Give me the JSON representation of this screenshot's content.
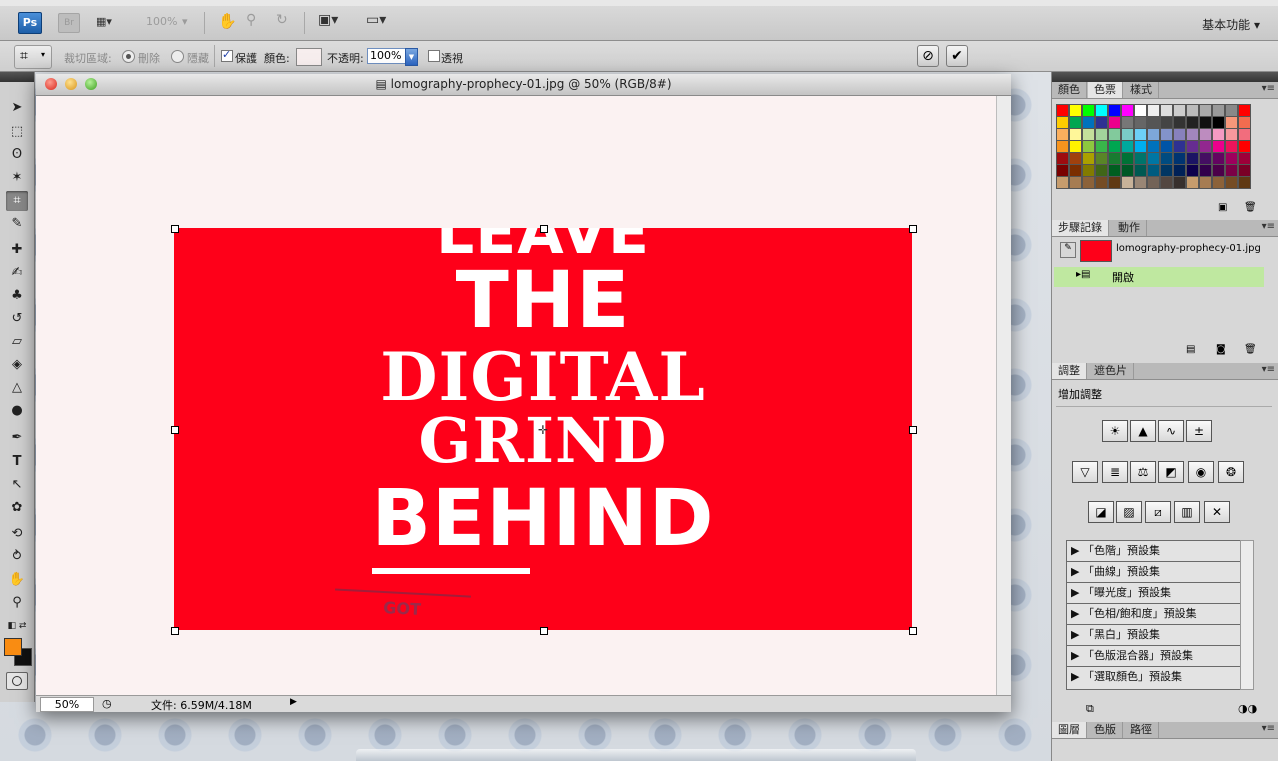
{
  "app": {
    "logo_ps": "Ps",
    "logo_br": "Br",
    "zoom_select": "100%",
    "workspace": "基本功能"
  },
  "options_bar": {
    "crop_area_label": "裁切區域:",
    "delete_label": "刪除",
    "hide_label": "隱藏",
    "shield_label": "保護",
    "color_label": "顏色:",
    "opacity_label": "不透明:",
    "opacity_value": "100%",
    "perspective_label": "透視",
    "cancel_icon": "cancel-icon",
    "commit_icon": "commit-icon"
  },
  "document": {
    "title": "lomography-prophecy-01.jpg @ 50% (RGB/8#)",
    "zoom": "50%",
    "file_info": "文件: 6.59M/4.18M",
    "poster": {
      "line1": "LEAVE",
      "line2": "THE",
      "line3": "DIGITAL",
      "line4": "GRIND",
      "line5": "BEHIND",
      "stamp": "GOT"
    },
    "image_color": "#fe0019"
  },
  "panels": {
    "color_tabs": [
      "顏色",
      "色票",
      "樣式"
    ],
    "history_tabs": [
      "步驟記錄",
      "動作"
    ],
    "history_snapshot": "lomography-prophecy-01.jpg",
    "history_step": "開啟",
    "adjust_tabs": [
      "調整",
      "遮色片"
    ],
    "adjust_heading": "增加調整",
    "presets": [
      "「色階」預設集",
      "「曲線」預設集",
      "「曝光度」預設集",
      "「色相/飽和度」預設集",
      "「黑白」預設集",
      "「色版混合器」預設集",
      "「選取顏色」預設集"
    ],
    "layers_tabs": [
      "圖層",
      "色版",
      "路徑"
    ]
  },
  "colors": {
    "foreground": "#f98c12",
    "background": "#111111"
  }
}
